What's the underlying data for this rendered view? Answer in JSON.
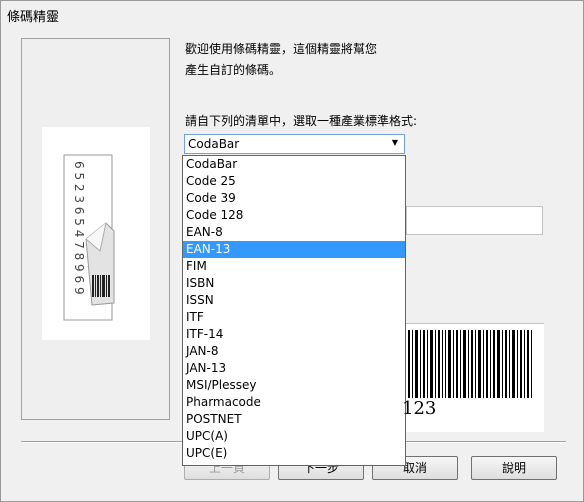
{
  "window": {
    "title": "條碼精靈"
  },
  "intro": {
    "line1": "歡迎使用條碼精靈，這個精靈將幫您",
    "line2": "產生自訂的條碼。"
  },
  "format": {
    "prompt": "請自下列的清單中，選取一種產業標準格式:",
    "selected": "CodaBar",
    "highlighted": "EAN-13",
    "options": [
      "CodaBar",
      "Code 25",
      "Code 39",
      "Code 128",
      "EAN-8",
      "EAN-13",
      "FIM",
      "ISBN",
      "ISSN",
      "ITF",
      "ITF-14",
      "JAN-8",
      "JAN-13",
      "MSI/Plessey",
      "Pharmacode",
      "POSTNET",
      "UPC(A)",
      "UPC(E)"
    ]
  },
  "illustration": {
    "digits": "6 5 2 3 6 5 4 7 8 9 6 9"
  },
  "preview": {
    "digits": "123"
  },
  "buttons": {
    "prev": "上一頁",
    "next": "下一步",
    "cancel": "取消",
    "help": "說明"
  }
}
